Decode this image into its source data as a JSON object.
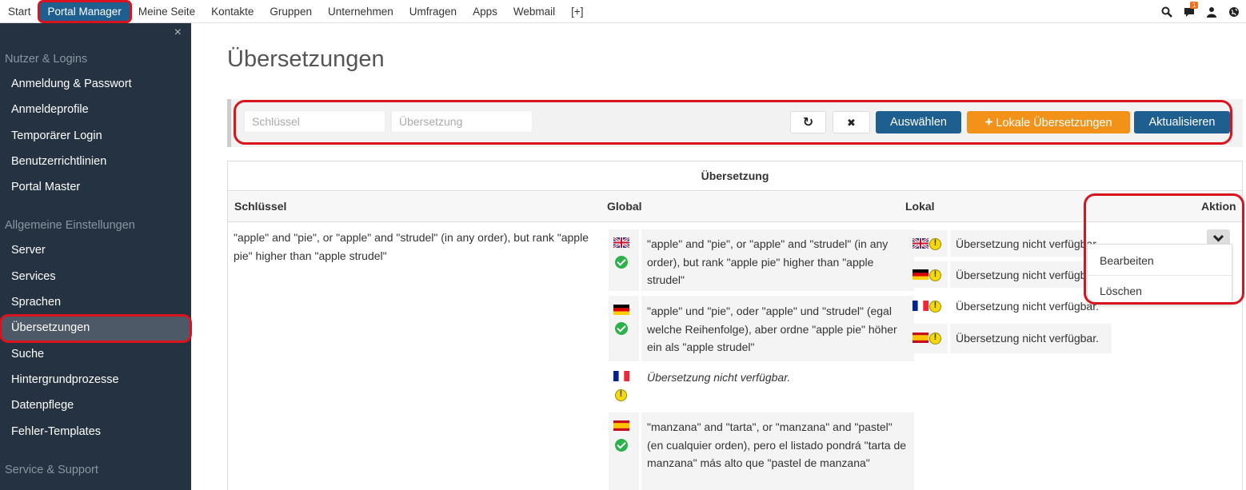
{
  "topnav": {
    "items": [
      "Start",
      "Portal Manager",
      "Meine Seite",
      "Kontakte",
      "Gruppen",
      "Unternehmen",
      "Umfragen",
      "Apps",
      "Webmail",
      "[+]"
    ],
    "notification_count": "1"
  },
  "sidebar": {
    "close": "×",
    "sections": [
      "Nutzer & Logins",
      "Allgemeine Einstellungen",
      "Service & Support"
    ],
    "items": [
      "Anmeldung & Passwort",
      "Anmeldeprofile",
      "Temporärer Login",
      "Benutzerrichtlinien",
      "Portal Master",
      "Server",
      "Services",
      "Sprachen",
      "Übersetzungen",
      "Suche",
      "Hintergrundprozesse",
      "Datenpflege",
      "Fehler-Templates"
    ]
  },
  "page": {
    "title": "Übersetzungen"
  },
  "filter": {
    "key_placeholder": "Schlüssel",
    "translation_placeholder": "Übersetzung",
    "refresh_icon": "↻",
    "clear_icon": "✖",
    "select_label": "Auswählen",
    "local_label": "Lokale Übersetzungen",
    "local_icon": "+",
    "update_label": "Aktualisieren"
  },
  "table": {
    "group_header": "Übersetzung",
    "col_key": "Schlüssel",
    "col_global": "Global",
    "col_local": "Lokal",
    "col_action": "Aktion",
    "row": {
      "key": "\"apple\" and \"pie\", or \"apple\" and \"strudel\" (in any order), but rank \"apple pie\" higher than \"apple strudel\"",
      "global": [
        {
          "lang": "en",
          "text": "\"apple\" and \"pie\", or \"apple\" and \"strudel\" (in any order), but rank \"apple pie\" higher than \"apple strudel\""
        },
        {
          "lang": "de",
          "text": "\"apple\" und \"pie\", oder \"apple\" und \"strudel\" (egal welche Reihenfolge), aber ordne \"apple pie\" höher ein als \"apple strudel\""
        },
        {
          "lang": "fr",
          "text": "Übersetzung nicht verfügbar."
        },
        {
          "lang": "es",
          "text": "\"manzana\" and \"tarta\", or \"manzana\" and \"pastel\" (en cualquier orden), pero el listado pondrá \"tarta de manzana\" más alto que \"pastel de manzana\""
        }
      ],
      "local": [
        {
          "lang": "en",
          "text": "Übersetzung nicht verfügbar."
        },
        {
          "lang": "de",
          "text": "Übersetzung nicht verfügbar."
        },
        {
          "lang": "fr",
          "text": "Übersetzung nicht verfügbar."
        },
        {
          "lang": "es",
          "text": "Übersetzung nicht verfügbar."
        }
      ]
    }
  },
  "action_menu": {
    "edit": "Bearbeiten",
    "delete": "Löschen"
  }
}
